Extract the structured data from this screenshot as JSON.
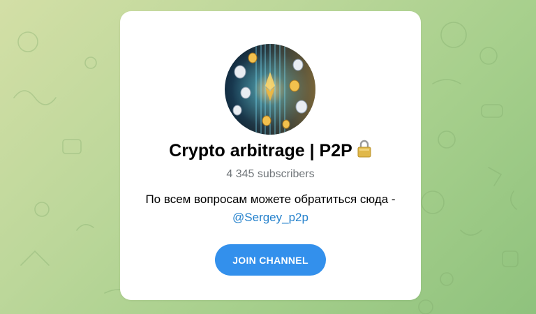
{
  "channel": {
    "title": "Crypto arbitrage | P2P",
    "subscribers": "4 345 subscribers",
    "description": "По всем вопросам можете обратиться сюда -",
    "contact_link": "@Sergey_p2p",
    "join_label": "JOIN CHANNEL"
  },
  "icons": {
    "title_emoji": "lock-icon",
    "avatar": "crypto-coins-avatar"
  },
  "colors": {
    "background": "#a6cf8c",
    "card": "#ffffff",
    "accent": "#3390ec",
    "link": "#2481cc",
    "muted": "#707579"
  }
}
